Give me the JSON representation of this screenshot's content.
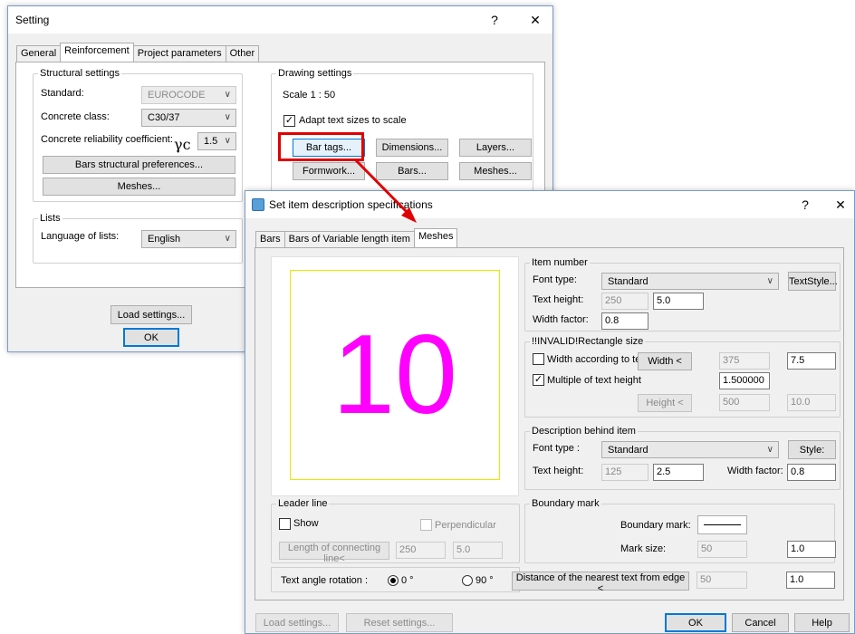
{
  "setting": {
    "title": "Setting",
    "help": "?",
    "close": "✕",
    "tabs": [
      "General",
      "Reinforcement",
      "Project parameters",
      "Other"
    ],
    "structural": {
      "title": "Structural settings",
      "standard_label": "Standard:",
      "standard_value": "EUROCODE",
      "concrete_class_label": "Concrete class:",
      "concrete_class_value": "C30/37",
      "reliability_label": "Concrete reliability coefficient:",
      "reliability_symbol": "γc",
      "reliability_value": "1.5",
      "bars_pref_button": "Bars structural preferences...",
      "meshes_button": "Meshes..."
    },
    "drawing": {
      "title": "Drawing settings",
      "scale": "Scale 1 : 50",
      "adapt_label": "Adapt text sizes to scale",
      "adapt_checked": "✓",
      "bar_tags": "Bar tags...",
      "dimensions": "Dimensions...",
      "layers": "Layers...",
      "formwork": "Formwork...",
      "bars": "Bars...",
      "meshes": "Meshes..."
    },
    "lists": {
      "title": "Lists",
      "language_label": "Language of lists:",
      "language_value": "English"
    },
    "load_settings": "Load settings...",
    "ok": "OK"
  },
  "item_desc": {
    "title": "Set item description specifications",
    "help": "?",
    "close": "✕",
    "tabs": [
      "Bars",
      "Bars of Variable length item",
      "Meshes"
    ],
    "preview_number": "10",
    "item_number": {
      "title": "Item number",
      "font_type_label": "Font type:",
      "font_type_value": "Standard",
      "textstyle_button": "TextStyle...",
      "text_height_label": "Text height:",
      "text_height_disabled": "250",
      "text_height_value": "5.0",
      "width_factor_label": "Width factor:",
      "width_factor_value": "0.8"
    },
    "rectangle": {
      "title": "!!INVALID!Rectangle size",
      "width_according_label": "Width according to te",
      "width_button": "Width <",
      "width_disabled": "375",
      "width_value": "7.5",
      "multiple_label": "Multiple of text height",
      "multiple_checked": "✓",
      "multiple_value": "1.500000",
      "height_button": "Height <",
      "height_disabled": "500",
      "height_value": "10.0"
    },
    "description": {
      "title": "Description behind item",
      "font_type_label": "Font type :",
      "font_type_value": "Standard",
      "style_button": "Style:",
      "text_height_label": "Text height:",
      "text_height_disabled": "125",
      "text_height_value": "2.5",
      "width_factor_label": "Width factor:",
      "width_factor_value": "0.8"
    },
    "leader": {
      "title": "Leader line",
      "show_label": "Show",
      "perpendicular_label": "Perpendicular",
      "length_button": "Length of connecting line<",
      "length_disabled": "250",
      "length_value": "5.0"
    },
    "boundary": {
      "title": "Boundary mark",
      "boundary_label": "Boundary mark:",
      "mark_size_label": "Mark size:",
      "mark_size_disabled": "50",
      "mark_size_value": "1.0"
    },
    "rotation": {
      "label": "Text angle rotation :",
      "opt0": "0 °",
      "opt90": "90 °",
      "selected": "0 °"
    },
    "distance": {
      "button": "Distance of the nearest text from edge <",
      "disabled": "50",
      "value": "1.0"
    },
    "footer": {
      "load_settings": "Load settings...",
      "reset_settings": "Reset settings...",
      "ok": "OK",
      "cancel": "Cancel",
      "help": "Help"
    }
  },
  "colors": {
    "highlight_red": "#e00000",
    "preview_magenta": "#ff00ff",
    "preview_frame": "#e8e800",
    "accent_blue": "#0078d7"
  }
}
